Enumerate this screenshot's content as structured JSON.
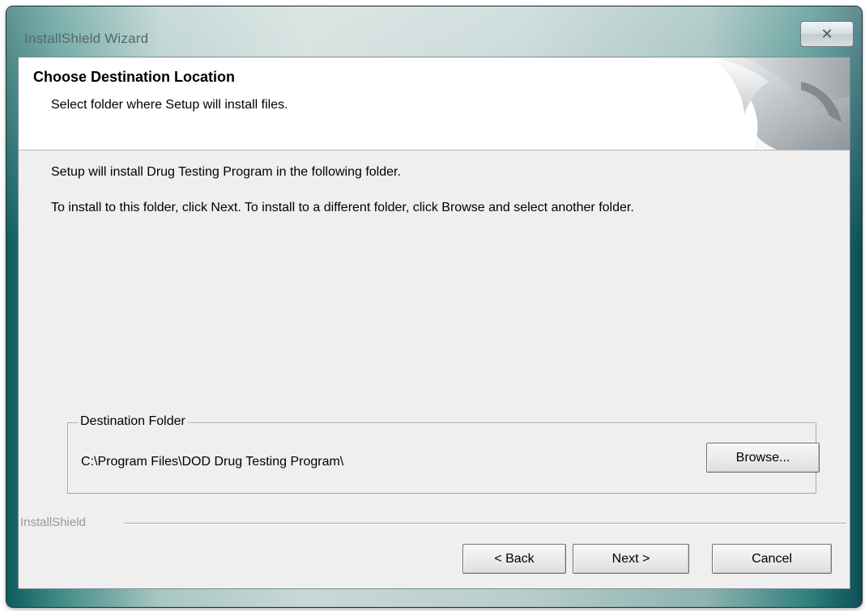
{
  "window": {
    "title": "InstallShield Wizard",
    "close_glyph": "✕",
    "close_icon": "close-icon"
  },
  "header": {
    "title": "Choose Destination Location",
    "subtitle": "Select folder where Setup will install files.",
    "graphic_icon": "page-curl-icon"
  },
  "body": {
    "line1": "Setup will install Drug Testing Program in the following folder.",
    "line2": "To install to this folder, click Next. To install to a different folder, click Browse and select another folder."
  },
  "destination": {
    "legend": "Destination Folder",
    "path": "C:\\Program Files\\DOD Drug Testing Program\\",
    "browse_label": "Browse..."
  },
  "brand": {
    "label": "InstallShield"
  },
  "buttons": {
    "back_label": "< Back",
    "next_label": "Next >",
    "cancel_label": "Cancel"
  },
  "colors": {
    "client_background": "#efefef",
    "header_background": "#ffffff",
    "frame_accent": "#3f8a84"
  }
}
